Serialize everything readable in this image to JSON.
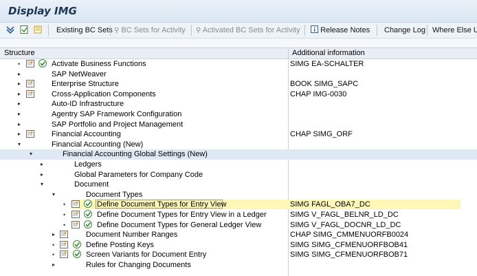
{
  "window": {
    "title": "Display IMG"
  },
  "toolbar": {
    "existing_bc_sets": "Existing BC Sets",
    "bc_sets_for_activity": "BC Sets for Activity",
    "activated_bc_sets": "Activated BC Sets for Activity",
    "release_notes": "Release Notes",
    "change_log": "Change Log",
    "where_else_used": "Where Else Us"
  },
  "columns": {
    "structure": "Structure",
    "additional": "Additional information"
  },
  "tree": [
    {
      "label": "Activate Business Functions",
      "info": "SIMG EA-SCHALTER"
    },
    {
      "label": "SAP NetWeaver",
      "info": ""
    },
    {
      "label": "Enterprise Structure",
      "info": "BOOK SIMG_SAPC"
    },
    {
      "label": "Cross-Application Components",
      "info": "CHAP IMG-0030"
    },
    {
      "label": "Auto-ID Infrastructure",
      "info": ""
    },
    {
      "label": "Agentry SAP Framework Configuration",
      "info": ""
    },
    {
      "label": "SAP Portfolio and Project Management",
      "info": ""
    },
    {
      "label": "Financial Accounting",
      "info": "CHAP SIMG_ORF"
    },
    {
      "label": "Financial Accounting (New)",
      "info": ""
    },
    {
      "label": "Financial Accounting Global Settings (New)",
      "info": ""
    },
    {
      "label": "Ledgers",
      "info": ""
    },
    {
      "label": "Global Parameters for Company Code",
      "info": ""
    },
    {
      "label": "Document",
      "info": ""
    },
    {
      "label": "Document Types",
      "info": ""
    },
    {
      "label": "Define Document Types for Entry View",
      "info": "SIMG FAGL_OBA7_DC"
    },
    {
      "label": "Define Document Types for Entry View in a Ledger",
      "info": "SIMG V_FAGL_BELNR_LD_DC"
    },
    {
      "label": "Define Document Types for General Ledger View",
      "info": "SIMG V_FAGL_DOCNR_LD_DC"
    },
    {
      "label": "Document Number Ranges",
      "info": "CHAP SIMG_CMMENUORFB0024"
    },
    {
      "label": "Define Posting Keys",
      "info": "SIMG SIMG_CFMENUORFBOB41"
    },
    {
      "label": "Screen Variants for Document Entry",
      "info": "SIMG SIMG_CFMENUORFBOB71"
    },
    {
      "label": "Rules for Changing Documents",
      "info": ""
    }
  ]
}
